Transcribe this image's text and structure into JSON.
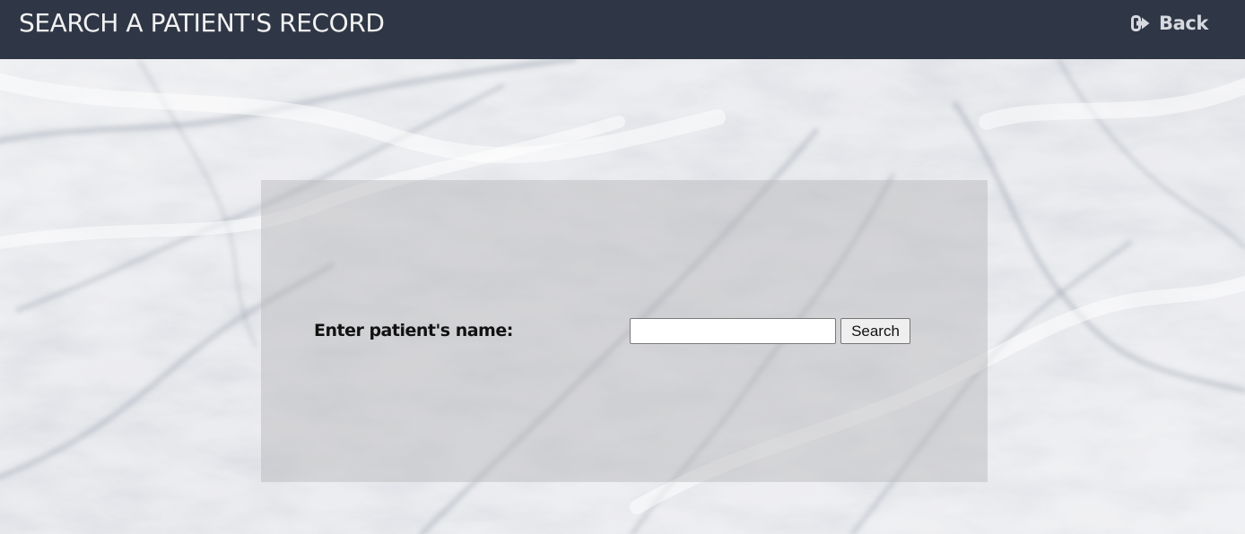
{
  "header": {
    "title": "SEARCH A PATIENT'S RECORD",
    "back_label": "Back",
    "back_icon": "sign-out-icon",
    "background_color": "#2f3746",
    "text_color": "#f2f2f2"
  },
  "background": {
    "style": "white-marble",
    "base_color": "#e9eaee"
  },
  "search_form": {
    "label": "Enter patient's name:",
    "input_value": "",
    "input_placeholder": "",
    "button_label": "Search",
    "panel_color": "rgba(181, 182, 185, 0.45)"
  }
}
